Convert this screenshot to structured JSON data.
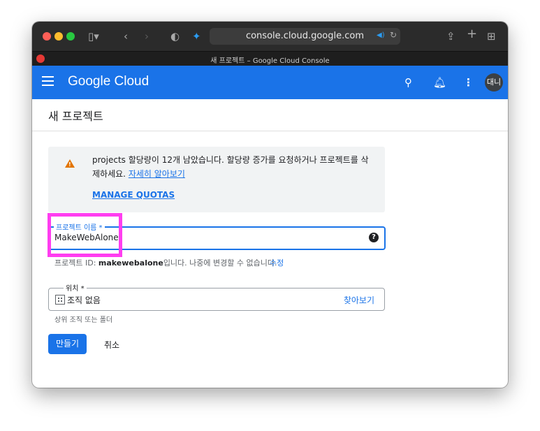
{
  "browser": {
    "url": "console.cloud.google.com",
    "tab_title": "새 프로젝트 – Google Cloud Console",
    "icons": [
      "sidebar-icon",
      "back-icon",
      "forward-icon",
      "shield-icon",
      "audio-icon",
      "reload-icon",
      "share-icon",
      "new-tab-icon",
      "tab-overview-icon"
    ]
  },
  "header": {
    "brand": "Google Cloud",
    "avatar": "대니",
    "color": "#1a73e8"
  },
  "page": {
    "title": "새 프로젝트"
  },
  "notice": {
    "text": "projects 할당량이 12개 남았습니다. 할당량 증가를 요청하거나 프로젝트를 삭제하세요.",
    "link": "자세히 알아보기",
    "action": "MANAGE QUOTAS"
  },
  "project_name": {
    "label": "프로젝트 이름 *",
    "value": "MakeWebAlone",
    "hint_prefix": "프로젝트 ID: ",
    "hint_id": "makewebalone",
    "hint_suffix": "입니다. 나중에 변경할 수 없습니다.",
    "edit": "수정"
  },
  "location": {
    "label": "위치 *",
    "value": "조직 없음",
    "browse": "찾아보기",
    "hint": "상위 조직 또는 폴더"
  },
  "actions": {
    "create": "만들기",
    "cancel": "취소"
  },
  "highlight_color": "#ff3df0"
}
